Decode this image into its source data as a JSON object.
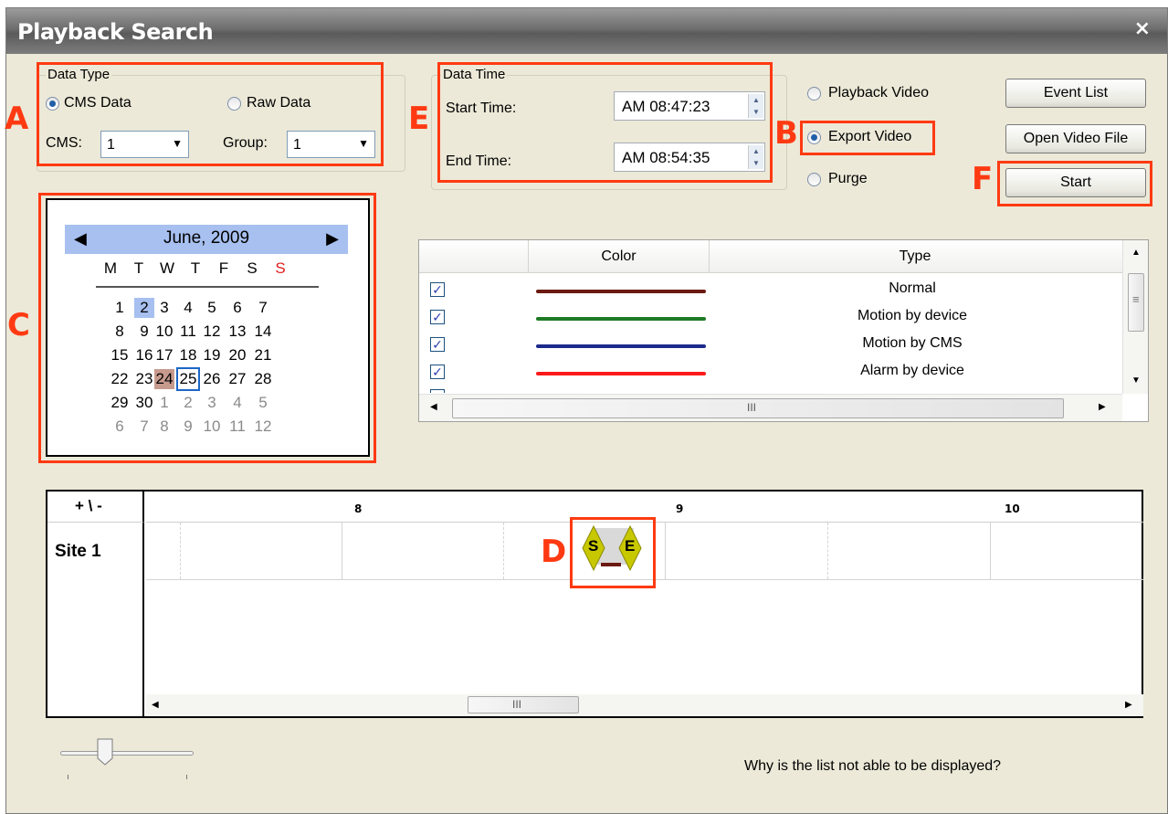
{
  "window": {
    "title": "Playback Search",
    "close_glyph": "×"
  },
  "data_type": {
    "legend": "Data Type",
    "cms_data_label": "CMS Data",
    "raw_data_label": "Raw Data",
    "selected": "CMS Data",
    "cms_label": "CMS:",
    "cms_value": "1",
    "group_label": "Group:",
    "group_value": "1"
  },
  "data_time": {
    "legend": "Data Time",
    "start_label": "Start Time:",
    "start_value": "AM  08:47:23",
    "end_label": "End Time:",
    "end_value": "AM  08:54:35"
  },
  "mode": {
    "playback_video": "Playback Video",
    "export_video": "Export Video",
    "purge": "Purge",
    "selected": "Export Video"
  },
  "buttons": {
    "event_list": "Event List",
    "open_video_file": "Open Video File",
    "start": "Start"
  },
  "callouts": {
    "a": "A",
    "b": "B",
    "c": "C",
    "d": "D",
    "e": "E",
    "f": "F"
  },
  "calendar": {
    "month_label": "June, 2009",
    "prev_glyph": "◀",
    "next_glyph": "▶",
    "weekdays": [
      "M",
      "T",
      "W",
      "T",
      "F",
      "S",
      "S"
    ],
    "weeks": [
      [
        "1",
        "2",
        "3",
        "4",
        "5",
        "6",
        "7"
      ],
      [
        "8",
        "9",
        "10",
        "11",
        "12",
        "13",
        "14"
      ],
      [
        "15",
        "16",
        "17",
        "18",
        "19",
        "20",
        "21"
      ],
      [
        "22",
        "23",
        "24",
        "25",
        "26",
        "27",
        "28"
      ],
      [
        "29",
        "30",
        "1",
        "2",
        "3",
        "4",
        "5"
      ],
      [
        "6",
        "7",
        "8",
        "9",
        "10",
        "11",
        "12"
      ]
    ],
    "selected_day": "2",
    "marked_day": "24",
    "today_day": "25"
  },
  "event_list": {
    "columns": [
      "",
      "Color",
      "Type"
    ],
    "rows": [
      {
        "checked": true,
        "color": "#6b1a12",
        "type": "Normal"
      },
      {
        "checked": true,
        "color": "#1e7a25",
        "type": "Motion by device"
      },
      {
        "checked": true,
        "color": "#1c2a8c",
        "type": "Motion by CMS"
      },
      {
        "checked": true,
        "color": "#ff1a1a",
        "type": "Alarm by device"
      }
    ],
    "scroll_grip": "III",
    "grip_glyph": "≡"
  },
  "timeline": {
    "zoom_label": "+ \\ -",
    "hours": [
      "8",
      "9",
      "10"
    ],
    "sites": [
      "Site 1"
    ],
    "start_marker": "S",
    "end_marker": "E",
    "scroll_grip": "III"
  },
  "footer": {
    "help_text": "Why is the list not able to be displayed?"
  },
  "colors": {
    "callout": "#ff3a12",
    "calendar_header": "#a7c0ef",
    "selected_day": "#a7c0ef",
    "marked_day": "#c79a8e",
    "today_border": "#1c66c6",
    "marker_yellow": "#c8c800"
  }
}
